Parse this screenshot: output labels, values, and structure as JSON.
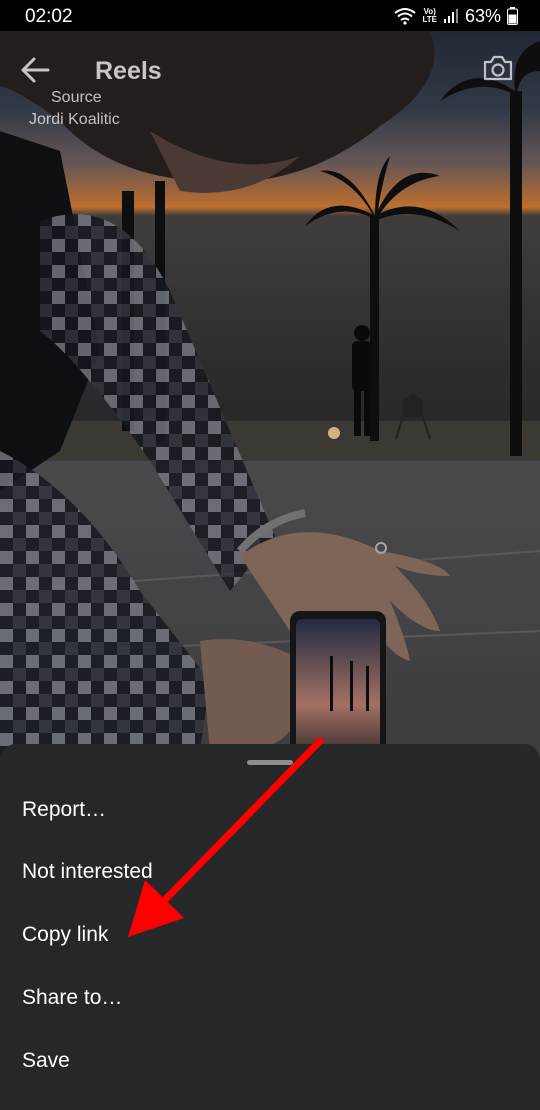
{
  "status_bar": {
    "time": "02:02",
    "network_label": "Vo)\nLTE",
    "battery_percent": "63%",
    "icons": [
      "wifi-calling-icon",
      "volte-icon",
      "signal-icon",
      "battery-icon"
    ]
  },
  "header": {
    "title": "Reels",
    "source_label": "Source",
    "source_author": "Jordi Koalitic",
    "back_icon": "arrow-left-icon",
    "camera_icon": "camera-icon"
  },
  "menu": {
    "items": [
      {
        "label": "Report…"
      },
      {
        "label": "Not interested"
      },
      {
        "label": "Copy link"
      },
      {
        "label": "Share to…"
      },
      {
        "label": "Save"
      }
    ]
  },
  "annotation": {
    "color": "#ff0000",
    "points_to": "Copy link"
  }
}
